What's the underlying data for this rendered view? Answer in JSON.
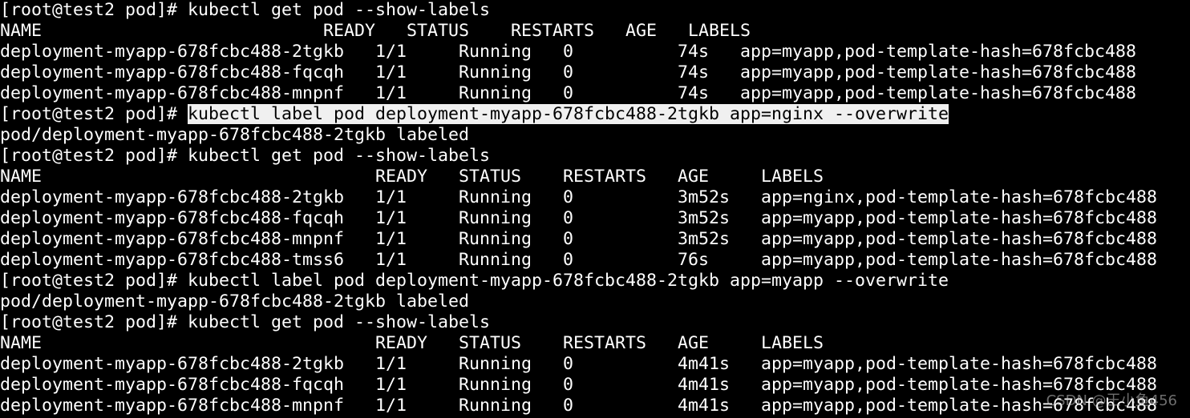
{
  "window": {
    "watermark": "CSDN @王小鱼456"
  },
  "prompt": "[root@test2 pod]# ",
  "lines": [
    {
      "kind": "command",
      "cmd": "kubectl get pod --show-labels"
    },
    {
      "kind": "output",
      "text": "NAME                           READY   STATUS    RESTARTS   AGE   LABELS"
    },
    {
      "kind": "output",
      "text": "deployment-myapp-678fcbc488-2tgkb   1/1     Running   0          74s   app=myapp,pod-template-hash=678fcbc488"
    },
    {
      "kind": "output",
      "text": "deployment-myapp-678fcbc488-fqcqh   1/1     Running   0          74s   app=myapp,pod-template-hash=678fcbc488"
    },
    {
      "kind": "output",
      "text": "deployment-myapp-678fcbc488-mnpnf   1/1     Running   0          74s   app=myapp,pod-template-hash=678fcbc488"
    },
    {
      "kind": "command",
      "cmd": "kubectl label pod deployment-myapp-678fcbc488-2tgkb app=nginx --overwrite",
      "selected": true
    },
    {
      "kind": "output",
      "text": "pod/deployment-myapp-678fcbc488-2tgkb labeled"
    },
    {
      "kind": "command",
      "cmd": "kubectl get pod --show-labels"
    },
    {
      "kind": "output",
      "text": "NAME                                READY   STATUS    RESTARTS   AGE     LABELS"
    },
    {
      "kind": "output",
      "text": "deployment-myapp-678fcbc488-2tgkb   1/1     Running   0          3m52s   app=nginx,pod-template-hash=678fcbc488"
    },
    {
      "kind": "output",
      "text": "deployment-myapp-678fcbc488-fqcqh   1/1     Running   0          3m52s   app=myapp,pod-template-hash=678fcbc488"
    },
    {
      "kind": "output",
      "text": "deployment-myapp-678fcbc488-mnpnf   1/1     Running   0          3m52s   app=myapp,pod-template-hash=678fcbc488"
    },
    {
      "kind": "output",
      "text": "deployment-myapp-678fcbc488-tmss6   1/1     Running   0          76s     app=myapp,pod-template-hash=678fcbc488"
    },
    {
      "kind": "command",
      "cmd": "kubectl label pod deployment-myapp-678fcbc488-2tgkb app=myapp --overwrite"
    },
    {
      "kind": "output",
      "text": "pod/deployment-myapp-678fcbc488-2tgkb labeled"
    },
    {
      "kind": "command",
      "cmd": "kubectl get pod --show-labels"
    },
    {
      "kind": "output",
      "text": "NAME                                READY   STATUS    RESTARTS   AGE     LABELS"
    },
    {
      "kind": "output",
      "text": "deployment-myapp-678fcbc488-2tgkb   1/1     Running   0          4m41s   app=myapp,pod-template-hash=678fcbc488"
    },
    {
      "kind": "output",
      "text": "deployment-myapp-678fcbc488-fqcqh   1/1     Running   0          4m41s   app=myapp,pod-template-hash=678fcbc488"
    },
    {
      "kind": "output",
      "text": "deployment-myapp-678fcbc488-mnpnf   1/1     Running   0          4m41s   app=myapp,pod-template-hash=678fcbc488"
    }
  ]
}
